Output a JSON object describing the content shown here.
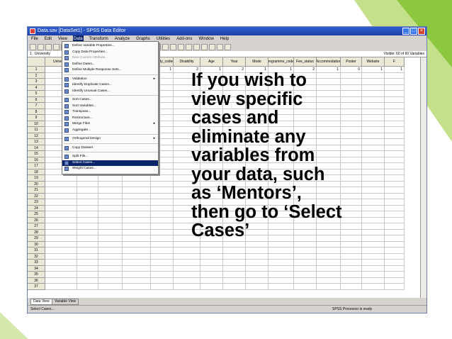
{
  "window": {
    "title": "Data.sav [DataSet1] - SPSS Data Editor",
    "controls": [
      "_",
      "□",
      "×"
    ]
  },
  "menubar": [
    "File",
    "Edit",
    "View",
    "Data",
    "Transform",
    "Analyze",
    "Graphs",
    "Utilities",
    "Add-ons",
    "Window",
    "Help"
  ],
  "cell_ref": "1 : University",
  "visible_vars": "Visible: 60 of 60 Variables",
  "columns": [
    "",
    "University",
    "",
    "",
    "Ethnicity",
    "Ethnicity_coded",
    "Disability",
    "Age",
    "Year",
    "Mode",
    "Programme_coded",
    "Fee_status",
    "Accommodation",
    "Poster",
    "Website",
    "F"
  ],
  "rows": [
    [
      "1",
      "",
      "",
      "",
      "",
      "1",
      "2",
      "1",
      "2",
      "1",
      "1",
      "2",
      "1",
      "0",
      "1",
      "1"
    ],
    [
      "2",
      "",
      "",
      "",
      "",
      "",
      "",
      "",
      "",
      "",
      "",
      "",
      "",
      "",
      "",
      ""
    ],
    [
      "3",
      "",
      "",
      "",
      "",
      "",
      "",
      "",
      "",
      "",
      "",
      "",
      "",
      "",
      "",
      ""
    ],
    [
      "4",
      "",
      "",
      "",
      "",
      "",
      "",
      "",
      "",
      "",
      "",
      "",
      "",
      "",
      "",
      ""
    ],
    [
      "5",
      "",
      "",
      "",
      "",
      "",
      "",
      "",
      "",
      "",
      "",
      "",
      "",
      "",
      "",
      ""
    ],
    [
      "6",
      "",
      "",
      "",
      "",
      "",
      "",
      "",
      "",
      "",
      "",
      "",
      "",
      "",
      "",
      ""
    ],
    [
      "7",
      "",
      "",
      "",
      "",
      "",
      "",
      "",
      "",
      "",
      "",
      "",
      "",
      "",
      "",
      ""
    ],
    [
      "8",
      "",
      "",
      "",
      "",
      "",
      "",
      "",
      "",
      "",
      "",
      "",
      "",
      "",
      "",
      ""
    ],
    [
      "9",
      "",
      "",
      "",
      "",
      "",
      "",
      "",
      "",
      "",
      "",
      "",
      "",
      "",
      "",
      ""
    ],
    [
      "10",
      "",
      "",
      "",
      "",
      "",
      "",
      "",
      "",
      "",
      "",
      "",
      "",
      "",
      "",
      ""
    ],
    [
      "11",
      "",
      "",
      "",
      "",
      "",
      "",
      "",
      "",
      "",
      "",
      "",
      "",
      "",
      "",
      ""
    ],
    [
      "12",
      "",
      "",
      "",
      "",
      "",
      "",
      "",
      "",
      "",
      "",
      "",
      "",
      "",
      "",
      ""
    ],
    [
      "13",
      "",
      "",
      "",
      "",
      "",
      "",
      "",
      "",
      "",
      "",
      "",
      "",
      "",
      "",
      ""
    ],
    [
      "14",
      "",
      "",
      "",
      "",
      "",
      "",
      "",
      "",
      "",
      "",
      "",
      "",
      "",
      "",
      ""
    ],
    [
      "15",
      "",
      "",
      "",
      "",
      "",
      "",
      "",
      "",
      "",
      "",
      "",
      "",
      "",
      "",
      ""
    ],
    [
      "16",
      "",
      "",
      "",
      "",
      "",
      "",
      "",
      "",
      "",
      "",
      "",
      "",
      "",
      "",
      ""
    ],
    [
      "17",
      "",
      "",
      "",
      "",
      "",
      "",
      "",
      "",
      "",
      "",
      "",
      "",
      "",
      "",
      ""
    ],
    [
      "18",
      "",
      "",
      "",
      "",
      "",
      "",
      "",
      "",
      "",
      "",
      "",
      "",
      "",
      "",
      ""
    ],
    [
      "19",
      "",
      "",
      "",
      "",
      "",
      "",
      "",
      "",
      "",
      "",
      "",
      "",
      "",
      "",
      ""
    ],
    [
      "20",
      "",
      "",
      "",
      "",
      "",
      "",
      "",
      "",
      "",
      "",
      "",
      "",
      "",
      "",
      ""
    ],
    [
      "21",
      "",
      "",
      "",
      "",
      "",
      "",
      "",
      "",
      "",
      "",
      "",
      "",
      "",
      "",
      ""
    ],
    [
      "22",
      "",
      "",
      "",
      "",
      "",
      "",
      "",
      "",
      "",
      "",
      "",
      "",
      "",
      "",
      ""
    ],
    [
      "23",
      "",
      "",
      "",
      "",
      "",
      "",
      "",
      "",
      "",
      "",
      "",
      "",
      "",
      "",
      ""
    ],
    [
      "24",
      "",
      "",
      "",
      "",
      "",
      "",
      "",
      "",
      "",
      "",
      "",
      "",
      "",
      "",
      ""
    ],
    [
      "25",
      "",
      "",
      "",
      "",
      "",
      "",
      "",
      "",
      "",
      "",
      "",
      "",
      "",
      "",
      ""
    ],
    [
      "26",
      "",
      "",
      "",
      "",
      "",
      "",
      "",
      "",
      "",
      "",
      "",
      "",
      "",
      "",
      ""
    ],
    [
      "27",
      "",
      "",
      "",
      "",
      "",
      "",
      "",
      "",
      "",
      "",
      "",
      "",
      "",
      "",
      ""
    ],
    [
      "28",
      "",
      "",
      "",
      "",
      "",
      "",
      "",
      "",
      "",
      "",
      "",
      "",
      "",
      "",
      ""
    ],
    [
      "29",
      "",
      "",
      "",
      "",
      "",
      "",
      "",
      "",
      "",
      "",
      "",
      "",
      "",
      "",
      ""
    ],
    [
      "30",
      "",
      "",
      "",
      "",
      "",
      "",
      "",
      "",
      "",
      "",
      "",
      "",
      "",
      "",
      ""
    ],
    [
      "31",
      "",
      "",
      "",
      "",
      "",
      "",
      "",
      "",
      "",
      "",
      "",
      "",
      "",
      "",
      ""
    ],
    [
      "32",
      "",
      "",
      "",
      "",
      "",
      "",
      "",
      "",
      "",
      "",
      "",
      "",
      "",
      "",
      ""
    ],
    [
      "33",
      "",
      "",
      "",
      "",
      "",
      "",
      "",
      "",
      "",
      "",
      "",
      "",
      "",
      "",
      ""
    ],
    [
      "34",
      "",
      "",
      "",
      "",
      "",
      "",
      "",
      "",
      "",
      "",
      "",
      "",
      "",
      "",
      ""
    ],
    [
      "35",
      "",
      "",
      "",
      "",
      "",
      "",
      "",
      "",
      "",
      "",
      "",
      "",
      "",
      "",
      ""
    ],
    [
      "36",
      "",
      "",
      "",
      "",
      "",
      "",
      "",
      "",
      "",
      "",
      "",
      "",
      "",
      "",
      ""
    ],
    [
      "37",
      "",
      "",
      "",
      "",
      "",
      "",
      "",
      "",
      "",
      "",
      "",
      "",
      "",
      "",
      ""
    ]
  ],
  "data_menu": [
    {
      "label": "Define Variable Properties...",
      "state": "normal"
    },
    {
      "label": "Copy Data Properties...",
      "state": "normal"
    },
    {
      "label": "New Custom Attribute...",
      "state": "disabled"
    },
    {
      "label": "Define Dates...",
      "state": "normal"
    },
    {
      "label": "Define Multiple Response Sets...",
      "state": "normal"
    },
    {
      "label": "Validation",
      "state": "submenu"
    },
    {
      "label": "Identify Duplicate Cases...",
      "state": "normal"
    },
    {
      "label": "Identify Unusual Cases...",
      "state": "normal"
    },
    {
      "label": "Sort Cases...",
      "state": "normal"
    },
    {
      "label": "Sort Variables...",
      "state": "normal"
    },
    {
      "label": "Transpose...",
      "state": "normal"
    },
    {
      "label": "Restructure...",
      "state": "normal"
    },
    {
      "label": "Merge Files",
      "state": "submenu"
    },
    {
      "label": "Aggregate...",
      "state": "normal"
    },
    {
      "label": "Orthogonal Design",
      "state": "submenu"
    },
    {
      "label": "Copy Dataset",
      "state": "normal"
    },
    {
      "label": "Split File...",
      "state": "normal"
    },
    {
      "label": "Select Cases...",
      "state": "selected"
    },
    {
      "label": "Weight Cases...",
      "state": "normal"
    }
  ],
  "tabs": {
    "data_view": "Data View",
    "variable_view": "Variable View"
  },
  "status": {
    "left": "Select Cases...",
    "right": "SPSS Processor is ready"
  },
  "overlay_lines": [
    "If you wish to",
    "view specific",
    "cases and",
    "eliminate any",
    "variables from",
    "your data, such",
    "as ‘Mentors’,",
    "then go to ‘Select",
    "Cases’"
  ],
  "colors": {
    "accent_green": "#8dc63f",
    "light_green": "#c4e08a",
    "title_blue": "#1c3fa8",
    "menu_highlight": "#0a246a"
  }
}
